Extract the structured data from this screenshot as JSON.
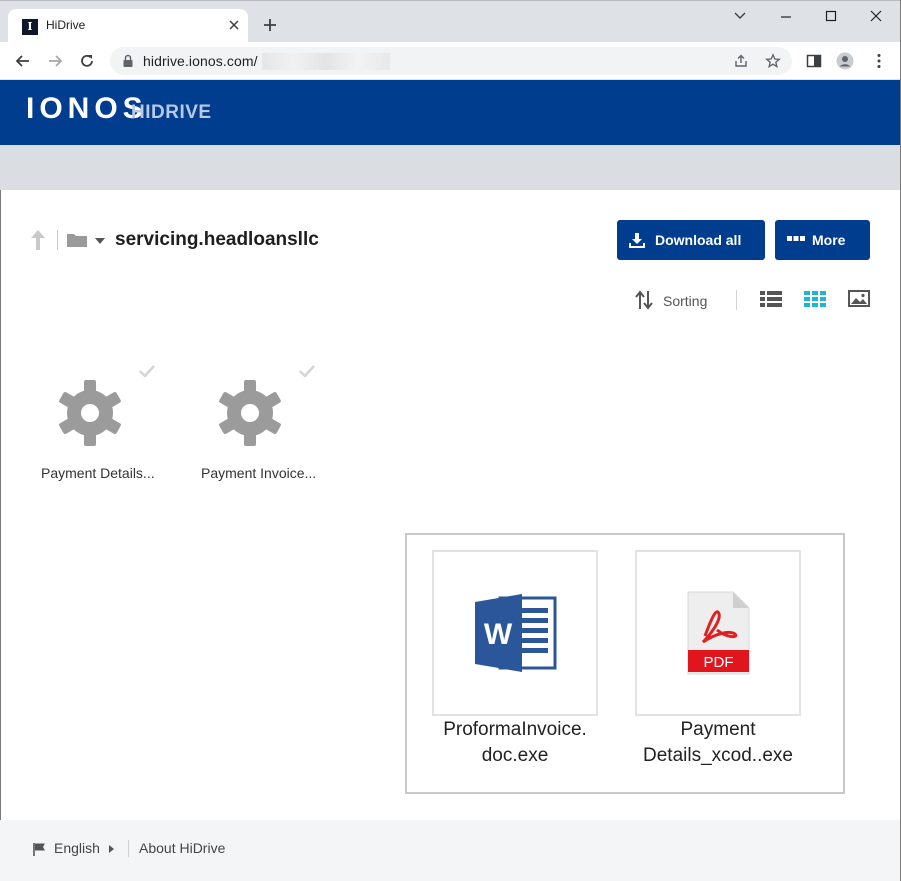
{
  "browser": {
    "tab_title": "HiDrive",
    "favicon_letter": "I",
    "url": "hidrive.ionos.com/"
  },
  "brand": {
    "logo": "IONOS",
    "product": "HIDRIVE",
    "color": "#003d8f"
  },
  "folder": {
    "title": "servicing.headloansllc"
  },
  "actions": {
    "download_all": "Download all",
    "more": "More"
  },
  "view": {
    "sorting_label": "Sorting",
    "active_view": "grid",
    "active_color": "#1fb5d8"
  },
  "files": [
    {
      "name": "Payment Details...",
      "icon": "gear-icon"
    },
    {
      "name": "Payment Invoice...",
      "icon": "gear-icon"
    }
  ],
  "preview": {
    "items": [
      {
        "line1": "ProformaInvoice.",
        "line2": "doc.exe",
        "icon": "word-icon"
      },
      {
        "line1": "Payment",
        "line2": "Details_xcod..exe",
        "icon": "pdf-icon",
        "badge": "PDF"
      }
    ]
  },
  "footer": {
    "language": "English",
    "about": "About HiDrive"
  }
}
